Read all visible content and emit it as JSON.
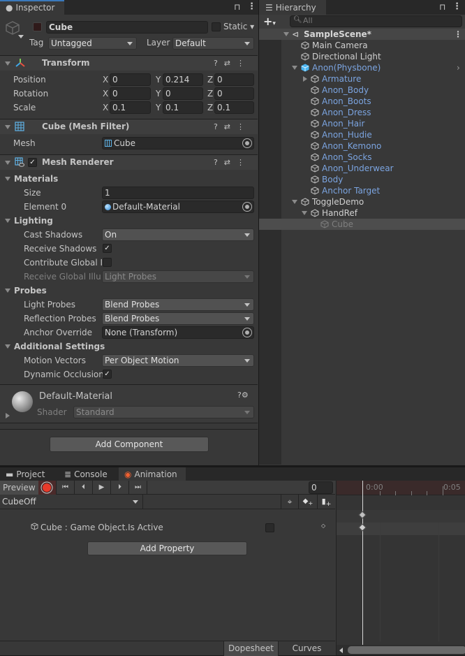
{
  "inspector": {
    "tab_label": "Inspector",
    "object_name": "Cube",
    "static_label": "Static",
    "tag_label": "Tag",
    "tag_value": "Untagged",
    "layer_label": "Layer",
    "layer_value": "Default",
    "transform": {
      "title": "Transform",
      "rows": [
        {
          "label": "Position",
          "x": "0",
          "y": "0.214",
          "z": "0"
        },
        {
          "label": "Rotation",
          "x": "0",
          "y": "0",
          "z": "0"
        },
        {
          "label": "Scale",
          "x": "0.1",
          "y": "0.1",
          "z": "0.1"
        }
      ],
      "axis_x": "X",
      "axis_y": "Y",
      "axis_z": "Z"
    },
    "mesh_filter": {
      "title": "Cube (Mesh Filter)",
      "mesh_label": "Mesh",
      "mesh_value": "Cube"
    },
    "mesh_renderer": {
      "title": "Mesh Renderer",
      "enabled": true,
      "materials_label": "Materials",
      "size_label": "Size",
      "size_value": "1",
      "element0_label": "Element 0",
      "element0_value": "Default-Material",
      "lighting_label": "Lighting",
      "cast_shadows_label": "Cast Shadows",
      "cast_shadows_value": "On",
      "receive_shadows_label": "Receive Shadows",
      "receive_shadows": true,
      "contribute_gi_label": "Contribute Global Ill",
      "contribute_gi": false,
      "receive_gi_label": "Receive Global Illun",
      "receive_gi_value": "Light Probes",
      "probes_label": "Probes",
      "light_probes_label": "Light Probes",
      "light_probes_value": "Blend Probes",
      "reflection_probes_label": "Reflection Probes",
      "reflection_probes_value": "Blend Probes",
      "anchor_override_label": "Anchor Override",
      "anchor_override_value": "None (Transform)",
      "additional_label": "Additional Settings",
      "motion_vectors_label": "Motion Vectors",
      "motion_vectors_value": "Per Object Motion",
      "dynamic_occlusion_label": "Dynamic Occlusion",
      "dynamic_occlusion": true
    },
    "material": {
      "name": "Default-Material",
      "shader_label": "Shader",
      "shader_value": "Standard"
    },
    "add_component_label": "Add Component"
  },
  "hierarchy": {
    "tab_label": "Hierarchy",
    "search_placeholder": "All",
    "scene_name": "SampleScene*",
    "items": [
      {
        "name": "Main Camera",
        "style": "normal"
      },
      {
        "name": "Directional Light",
        "style": "normal"
      },
      {
        "name": "Anon(Physbone)",
        "style": "prefab-root"
      },
      {
        "name": "Armature",
        "style": "prefab"
      },
      {
        "name": "Anon_Body",
        "style": "prefab"
      },
      {
        "name": "Anon_Boots",
        "style": "prefab"
      },
      {
        "name": "Anon_Dress",
        "style": "prefab"
      },
      {
        "name": "Anon_Hair",
        "style": "prefab"
      },
      {
        "name": "Anon_Hudie",
        "style": "prefab"
      },
      {
        "name": "Anon_Kemono",
        "style": "prefab"
      },
      {
        "name": "Anon_Socks",
        "style": "prefab"
      },
      {
        "name": "Anon_Underwear",
        "style": "prefab"
      },
      {
        "name": "Body",
        "style": "prefab"
      },
      {
        "name": "Anchor Target",
        "style": "prefab"
      },
      {
        "name": "ToggleDemo",
        "style": "normal"
      },
      {
        "name": "HandRef",
        "style": "normal"
      },
      {
        "name": "Cube",
        "style": "inactive-selected"
      }
    ]
  },
  "bottom": {
    "tabs": [
      "Project",
      "Console",
      "Animation"
    ],
    "preview_label": "Preview",
    "frame_value": "0",
    "clip_name": "CubeOff",
    "property_label": "Cube : Game Object.Is Active",
    "property_value": false,
    "add_property_label": "Add Property",
    "dopesheet_label": "Dopesheet",
    "curves_label": "Curves",
    "timeline_ticks": [
      "0:00",
      "0:05"
    ]
  },
  "colors": {
    "accent": "#3a79bb",
    "record": "#e83a2a",
    "prefab_text": "#7ba4e0"
  }
}
